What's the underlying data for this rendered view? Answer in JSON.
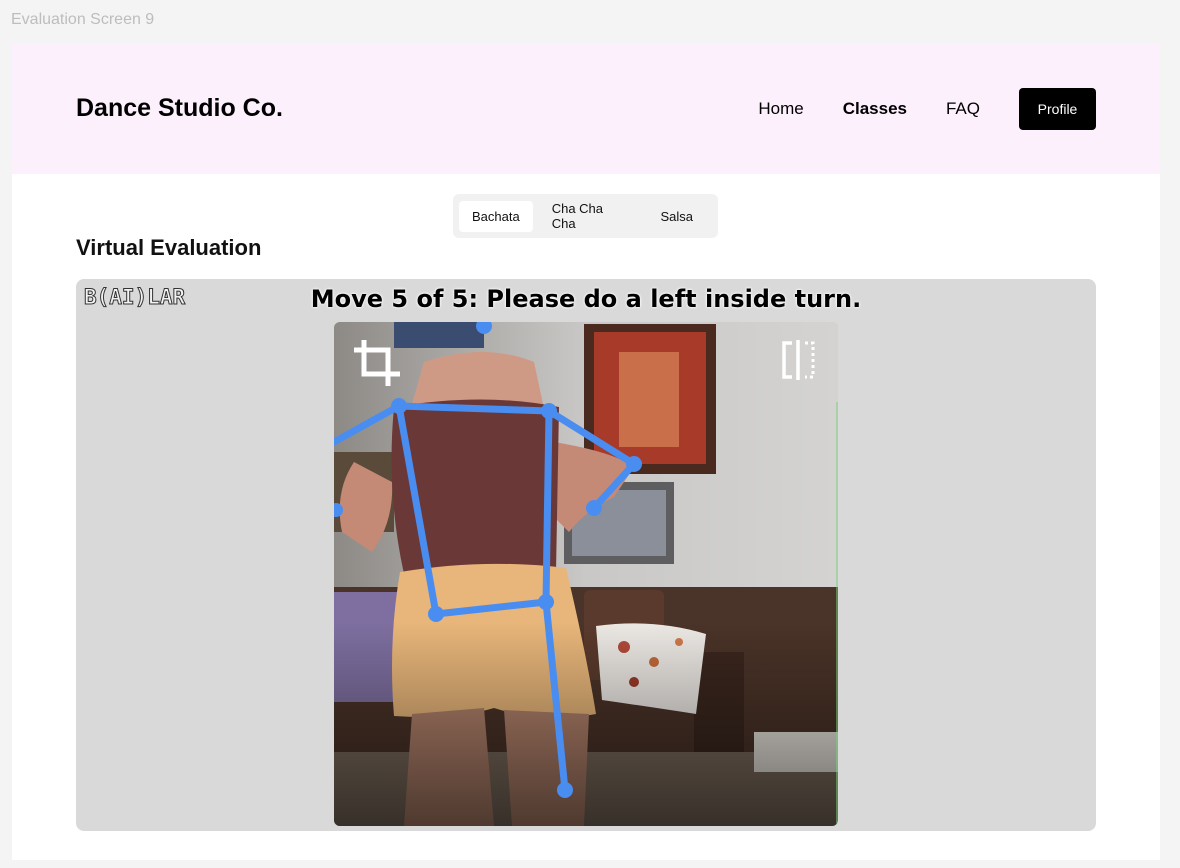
{
  "frame_label": "Evaluation Screen 9",
  "header": {
    "brand": "Dance Studio Co.",
    "nav": [
      {
        "label": "Home",
        "active": false
      },
      {
        "label": "Classes",
        "active": true
      },
      {
        "label": "FAQ",
        "active": false
      }
    ],
    "profile_button": "Profile"
  },
  "tabs": [
    {
      "label": "Bachata",
      "active": true
    },
    {
      "label": "Cha Cha Cha",
      "active": false
    },
    {
      "label": "Salsa",
      "active": false
    }
  ],
  "section_title": "Virtual Evaluation",
  "evaluation": {
    "logo": "B(AI)LAR",
    "prompt": "Move 5 of 5: Please do a left inside turn.",
    "icons": {
      "crop": "crop-icon",
      "flip": "flip-horizontal-icon"
    }
  },
  "colors": {
    "header_bg": "#fdf0fd",
    "skeleton": "#4a8df0",
    "panel_bg": "#d9d9d9",
    "button_bg": "#000000"
  }
}
